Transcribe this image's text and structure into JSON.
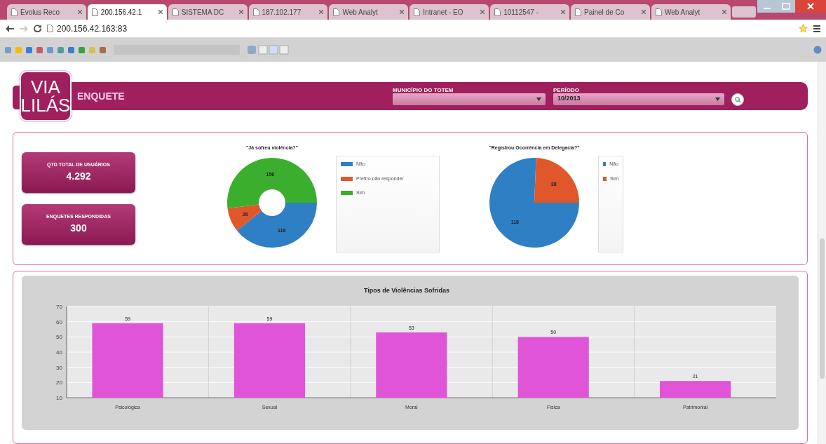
{
  "browser": {
    "tabs": [
      {
        "label": "Evolus Reco",
        "selected": false
      },
      {
        "label": "200.156.42.1",
        "selected": true
      },
      {
        "label": "SISTEMA DC",
        "selected": false
      },
      {
        "label": "187.102.177",
        "selected": false
      },
      {
        "label": "Web Analyt",
        "selected": false
      },
      {
        "label": "Intranet - EO",
        "selected": false
      },
      {
        "label": "10112547 -",
        "selected": false
      },
      {
        "label": "Painel de Co",
        "selected": false
      },
      {
        "label": "Web Analyt",
        "selected": false
      }
    ],
    "address": "200.156.42.163:83"
  },
  "header": {
    "logo": [
      "VIA",
      "LILÁS"
    ],
    "title": "ENQUETE",
    "filters": [
      {
        "label": "MUNICÍPIO DO TOTEM"
      },
      {
        "label": "PERÍODO",
        "value": "10/2013"
      }
    ]
  },
  "stats": [
    {
      "label": "QTD TOTAL DE USUÁRIOS",
      "value": "4.292"
    },
    {
      "label": "ENQUETES RESPONDIDAS",
      "value": "300"
    }
  ],
  "pies": [
    {
      "chart_data": {
        "type": "donut",
        "title": "\"Já sofreu violência?\"",
        "categories": [
          "Não",
          "Prefiro não responder",
          "Sim"
        ],
        "series": [
          {
            "values": [
              118,
              26,
              156
            ]
          }
        ],
        "data_labels": true,
        "legend": true
      },
      "slices": [
        {
          "color": "#2f7fc4"
        },
        {
          "color": "#e0572b"
        },
        {
          "color": "#3cae2e"
        }
      ]
    },
    {
      "chart_data": {
        "type": "pie",
        "title": "\"Registrou Ocorrência em Delegacia?\"",
        "categories": [
          "Não",
          "Sim"
        ],
        "series": [
          {
            "values": [
              118,
              38
            ]
          }
        ],
        "data_labels": true,
        "legend": true
      },
      "slices": [
        {
          "color": "#2f7fc4"
        },
        {
          "color": "#e0572b"
        }
      ]
    }
  ],
  "bars": {
    "chart_data": {
      "type": "bar",
      "title": "Tipos de Violências Sofridas",
      "categories": [
        "Psicológica",
        "Sexual",
        "Moral",
        "Física",
        "Patrimonial"
      ],
      "series": [
        {
          "color": "#e055d8",
          "values": [
            59,
            59,
            53,
            50,
            21
          ]
        }
      ],
      "ylim": [
        10,
        70
      ],
      "yticks": [
        10,
        20,
        30,
        40,
        50,
        60,
        70
      ],
      "data_labels": true,
      "grid": true
    }
  }
}
